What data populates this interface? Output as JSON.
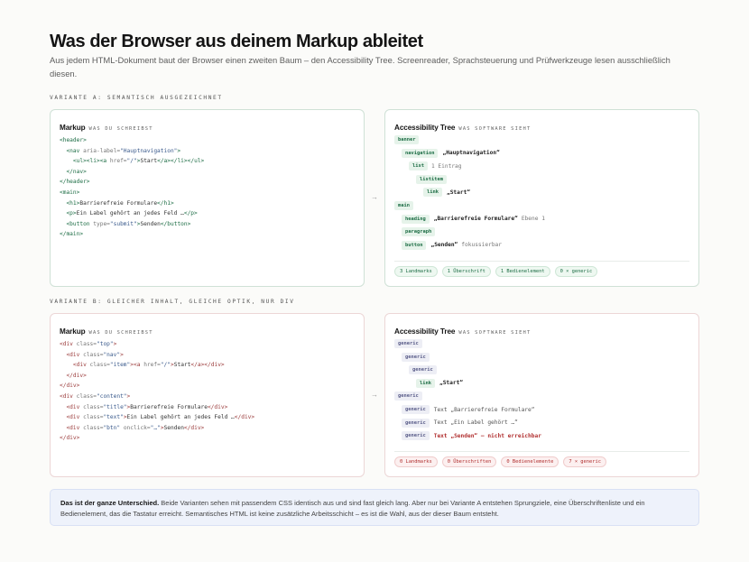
{
  "title": "Was der Browser aus deinem Markup ableitet",
  "lede": "Aus jedem HTML-Dokument baut der Browser einen zweiten Baum – den Accessibility Tree. Screenreader, Sprachsteuerung und Prüfwerkzeuge lesen ausschließlich diesen.",
  "variant_a": {
    "label": "Variante A: semantisch ausgezeichnet",
    "code_title": "Markup",
    "code_sub": "was du schreibst",
    "tree_title": "Accessibility Tree",
    "tree_sub": "was Software sieht",
    "arrow": "→",
    "tree": [
      {
        "role": "banner",
        "name": "",
        "extra": ""
      },
      {
        "role": "navigation",
        "name": "„Hauptnavigation“",
        "extra": ""
      },
      {
        "role": "list",
        "name": "",
        "extra": "1 Eintrag"
      },
      {
        "role": "listitem",
        "name": "",
        "extra": ""
      },
      {
        "role": "link",
        "name": "„Start“",
        "extra": ""
      },
      {
        "role": "main",
        "name": "",
        "extra": ""
      },
      {
        "role": "heading",
        "name": "„Barrierefreie Formulare“",
        "extra": "Ebene 1"
      },
      {
        "role": "paragraph",
        "name": "",
        "extra": ""
      },
      {
        "role": "button",
        "name": "„Senden“",
        "extra": "fokussierbar"
      }
    ],
    "chips": [
      "3 Landmarks",
      "1 Überschrift",
      "1 Bedienelement",
      "0 × generic"
    ]
  },
  "variant_b": {
    "label": "Variante B: gleicher Inhalt, gleiche Optik, nur div",
    "code_title": "Markup",
    "code_sub": "was du schreibst",
    "tree_title": "Accessibility Tree",
    "tree_sub": "was Software sieht",
    "arrow": "→",
    "tree": [
      {
        "role": "generic",
        "text": ""
      },
      {
        "role": "generic",
        "text": ""
      },
      {
        "role": "generic",
        "text": ""
      },
      {
        "role": "link",
        "text": "„Start“"
      },
      {
        "role": "generic",
        "text": ""
      },
      {
        "role": "generic",
        "text": "Text „Barrierefreie Formulare“"
      },
      {
        "role": "generic",
        "text": "Text „Ein Label gehört …“"
      },
      {
        "role": "generic",
        "text": "Text „Senden“ – nicht erreichbar"
      }
    ],
    "chips": [
      "0 Landmarks",
      "0 Überschriften",
      "0 Bedienelemente",
      "7 × generic"
    ]
  },
  "note": {
    "strong": "Das ist der ganze Unterschied.",
    "text": " Beide Varianten sehen mit passendem CSS identisch aus und sind fast gleich lang. Aber nur bei Variante A entstehen Sprungziele, eine Überschriftenliste und ein Bedienelement, das die Tastatur erreicht. Semantisches HTML ist keine zusätzliche Arbeitsschicht – es ist die Wahl, aus der dieser Baum entsteht."
  }
}
